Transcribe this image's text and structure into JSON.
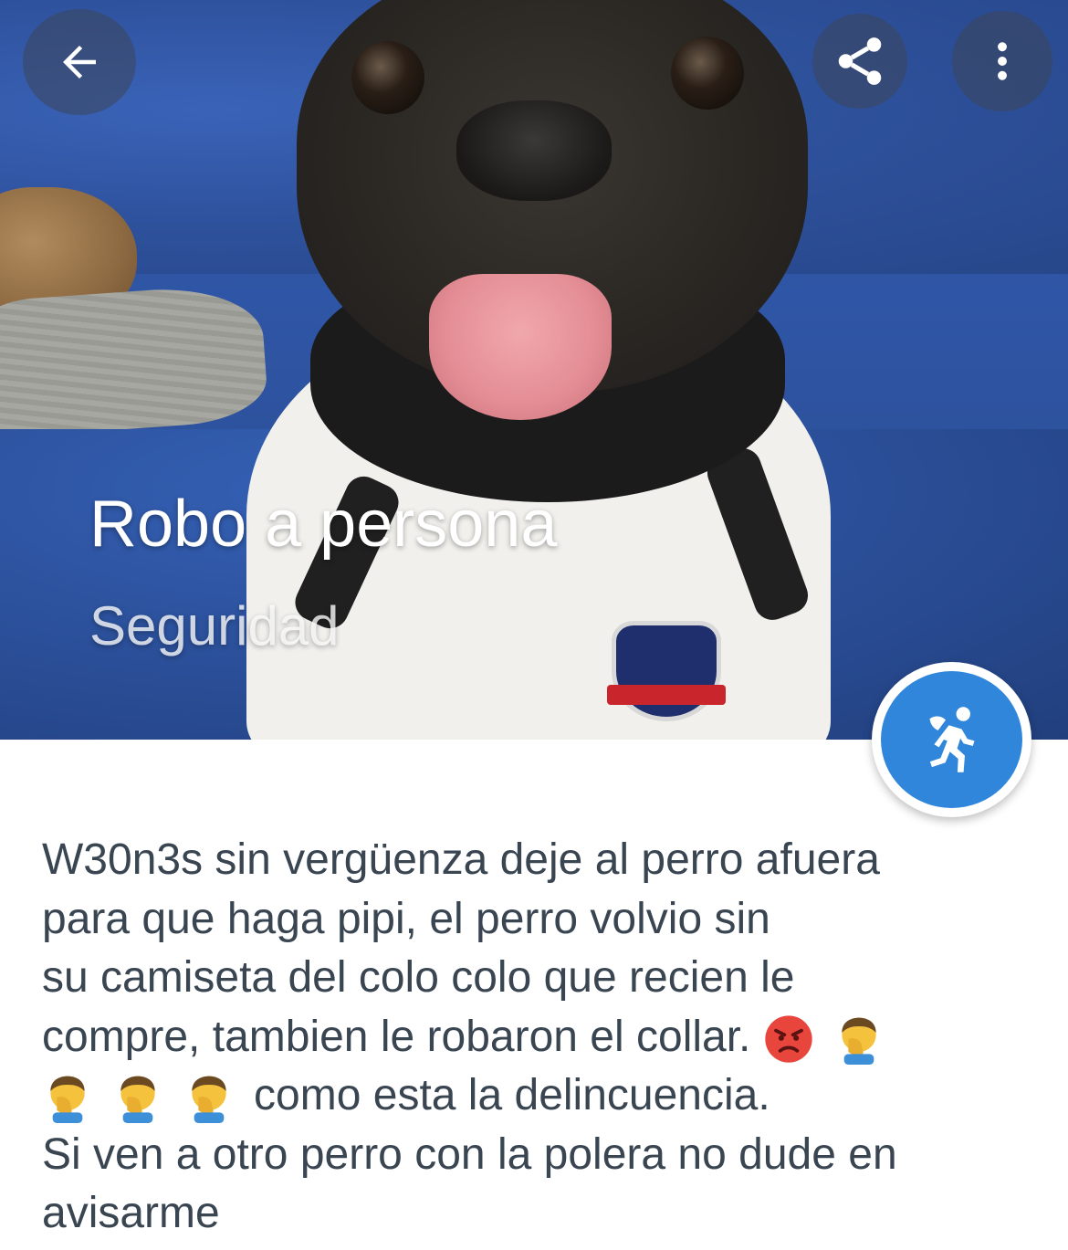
{
  "header": {
    "back_icon": "arrow-left-icon",
    "share_icon": "share-icon",
    "more_icon": "more-vert-icon"
  },
  "report": {
    "title": "Robo a persona",
    "category": "Seguridad",
    "category_icon": "thief-running-icon"
  },
  "description": {
    "lines": [
      "W30n3s sin vergüenza deje al perro afuera",
      "para que haga pipi, el perro volvio sin",
      "su camiseta del colo colo que recien le",
      "compre, tambien le robaron el collar.",
      "como esta la delincuencia.",
      "Si ven a otro perro con la polera no dude en",
      "avisarme"
    ],
    "emojis": [
      "angry-face-emoji",
      "facepalm-emoji",
      "facepalm-emoji",
      "facepalm-emoji",
      "facepalm-emoji"
    ]
  },
  "colors": {
    "accent": "#2f86db",
    "text": "#3a4552"
  }
}
